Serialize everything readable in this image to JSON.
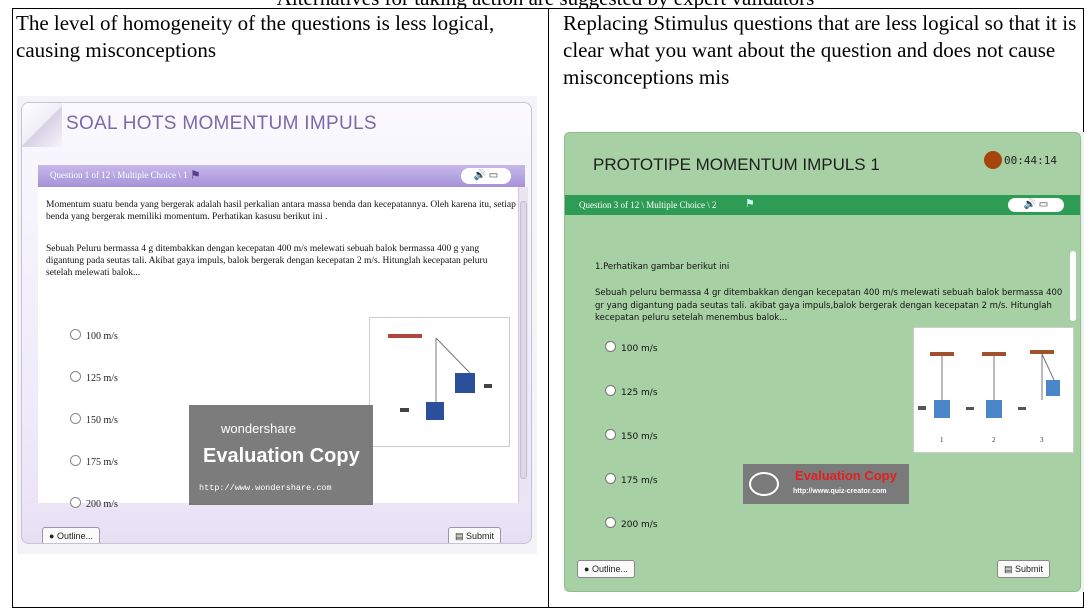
{
  "top_clip": "Alternatives for taking action are suggested by expert validators",
  "left_caption": "The level of homogeneity of the questions is less logical, causing misconceptions",
  "right_caption": "Replacing Stimulus questions that are less logical so that it is clear what you want about the question and does not cause misconceptions mis",
  "left_app": {
    "title": "SOAL HOTS MOMENTUM IMPULS",
    "question_header": "Question 1 of 12 \\ Multiple Choice \\ 1",
    "paragraph1": "Momentum suatu benda yang bergerak adalah hasil perkalian antara massa benda dan kecepatannya. Oleh karena itu, setiap benda yang bergerak memiliki momentum. Perhatikan kasusu berikut ini .",
    "paragraph2": "Sebuah Peluru bermassa 4 g ditembakkan dengan kecepatan 400 m/s melewati sebuah balok bermassa 400 g yang digantung pada seutas tali. Akibat gaya impuls, balok bergerak dengan kecepatan 2 m/s. Hitunglah kecepatan peluru setelah melewati balok...",
    "options": [
      "100  m/s",
      "125 m/s",
      "150 m/s",
      "175 m/s",
      "200 m/s"
    ],
    "watermark_brand": "wondershare",
    "watermark_eval": "Evaluation Copy",
    "watermark_url": "http://www.wondershare.com",
    "outline_label": "Outline...",
    "submit_label": "Submit"
  },
  "right_app": {
    "title": "PROTOTIPE MOMENTUM IMPULS 1",
    "timer": "00:44:14",
    "question_header": "Question 3 of 12 \\ Multiple Choice \\ 2",
    "instruction": "1.Perhatikan gambar berikut ini",
    "paragraph": "Sebuah peluru bermassa 4 gr ditembakkan dengan kecepatan 400 m/s melewati sebuah balok bermassa 400 gr yang digantung pada seutas tali. akibat gaya impuls,balok bergerak dengan kecepatan 2 m/s. Hitunglah kecepatan peluru setelah menembus balok...",
    "options": [
      "100 m/s",
      "125 m/s",
      "150 m/s",
      "175 m/s",
      "200 m/s"
    ],
    "figure_labels": [
      "1",
      "2",
      "3"
    ],
    "watermark_eval": "Evaluation Copy",
    "watermark_url": "http://www.quiz-creator.com",
    "outline_label": "Outline...",
    "submit_label": "Submit"
  }
}
